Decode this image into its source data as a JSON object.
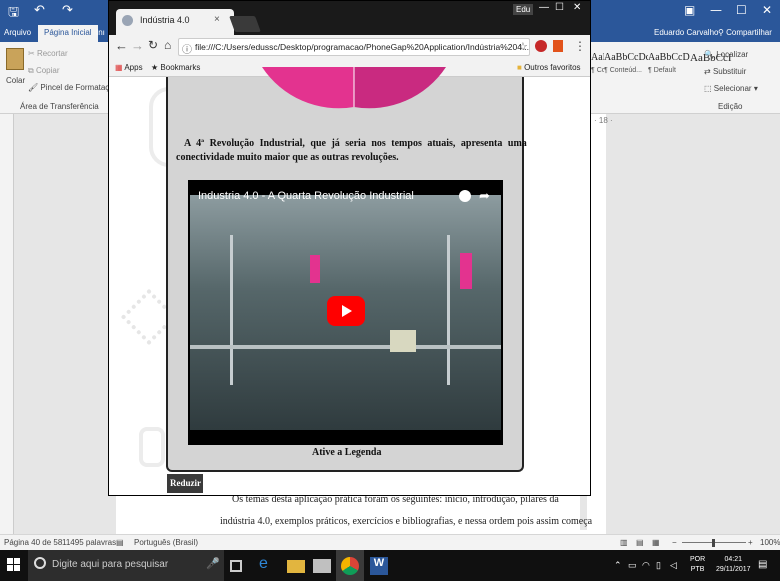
{
  "word": {
    "window_controls": [
      "Edu",
      "—",
      "☐",
      "✕"
    ],
    "tabs": [
      "Arquivo",
      "Página Inicial",
      "Inı"
    ],
    "active_tab": "Página Inicial",
    "user": "Eduardo Carvalho",
    "share": "Compartilhar",
    "clipboard": {
      "paste": "Colar",
      "cut": "Recortar",
      "copy": "Copiar",
      "format_painter": "Pincel de Formatação",
      "group": "Área de Transferência"
    },
    "styles": [
      {
        "sample": "AaBbCcDc",
        "name": "¶ Conteúd..."
      },
      {
        "sample": "AaBbCcDc",
        "name": "¶ Default"
      },
      {
        "sample": "AaBbCcI",
        "name": ""
      }
    ],
    "editing": {
      "find": "Localizar",
      "replace": "Substituir",
      "select": "Selecionar",
      "group": "Edição"
    },
    "ruler_mark": "· 18 ·",
    "doc_line1": "Os temas desta aplicação prática foram os seguintes: início, introdução, pilares da",
    "doc_line2": "indústria 4.0, exemplos práticos, exercícios e bibliografias, e nessa ordem pois assim começa",
    "status": {
      "page": "Página 40 de 58",
      "words": "11495 palavras",
      "language": "Português (Brasil)",
      "zoom": "100%"
    }
  },
  "chrome": {
    "tab_title": "Indústria 4.0",
    "tab_close": "×",
    "user_badge": "Edu",
    "url": "file:///C:/Users/edussc/Desktop/programacao/PhoneGap%20Application/Indústria%204...",
    "bookmarks": {
      "apps": "Apps",
      "bookmarks": "Bookmarks",
      "other": "Outros favoritos"
    }
  },
  "app": {
    "paragraph_line1": "A 4ª Revolução Industrial, que já seria nos tempos atuais, apresenta uma",
    "paragraph_line2": "conectividade muito maior que as outras revoluções.",
    "video_title": "Industria 4.0 - A Quarta Revolução Industrial",
    "caption": "Ative a Legenda",
    "reduce_button": "Reduzir"
  },
  "taskbar": {
    "search_placeholder": "Digite aqui para pesquisar",
    "lang1": "POR",
    "lang2": "PTB",
    "time": "04:21",
    "date": "29/11/2017"
  },
  "colors": {
    "word_blue": "#2b579a",
    "youtube_red": "#ff0000",
    "pink": "#e3338f"
  }
}
